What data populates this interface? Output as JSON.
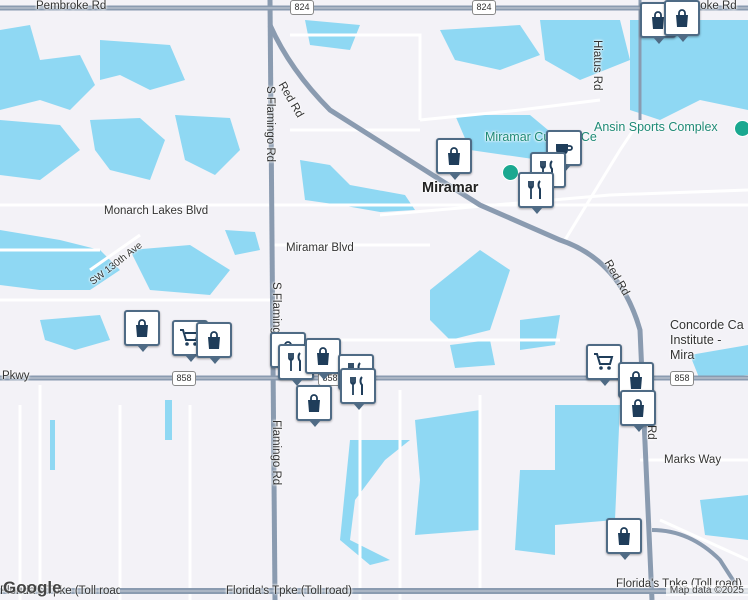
{
  "labels": {
    "pembroke_rd": "Pembroke Rd",
    "pembroke_rd_right": "broke Rd",
    "hiatus_rd": "Hiatus Rd",
    "red_rd_north": "Red Rd",
    "red_rd_east": "Red Rd",
    "red_rd_south": "Rd",
    "s_flamingo_rd_top": "S Flamingo Rd",
    "s_flamingo_rd_mid": "S Flamingo Rd",
    "flamingo_rd_south": "Flamingo Rd",
    "monarch_lakes_blvd": "Monarch Lakes Blvd",
    "miramar_blvd": "Miramar Blvd",
    "sw_130th_ave": "SW 130th Ave",
    "pkwy": "Pkwy",
    "marks_way": "Marks Way",
    "floridas_tpke_center": "Florida's Tpke (Toll road)",
    "floridas_tpke_left": "Florida's Tpke (Toll road)",
    "floridas_tpke_right": "Florida's Tpke (Toll road)",
    "miramar": "Miramar",
    "miramar_cultural_center": "Miramar Cultural Ce",
    "ansin_sports_complex": "Ansin Sports Complex",
    "concorde_institute": "Concorde Ca Institute - Mira"
  },
  "shields": {
    "route_824_left": "824",
    "route_824_right": "824",
    "route_858_left": "858",
    "route_858_mid": "858",
    "route_858_right": "858"
  },
  "attribution": {
    "google": "Google",
    "map_data": "Map data ©2025"
  },
  "colors": {
    "water": "#8fd8f3",
    "land": "#f3f2f7",
    "road_major": "#8a9bb0",
    "road_minor": "#ffffff",
    "pin_border": "#4f6b85",
    "pin_icon": "#1f3d5a"
  },
  "markers": [
    {
      "type": "shopping-bag"
    },
    {
      "type": "shopping-bag"
    },
    {
      "type": "shopping-cart"
    },
    {
      "type": "shopping-bag"
    },
    {
      "type": "shopping-bag"
    },
    {
      "type": "restaurant"
    },
    {
      "type": "shopping-bag"
    },
    {
      "type": "restaurant"
    },
    {
      "type": "restaurant"
    },
    {
      "type": "shopping-bag"
    },
    {
      "type": "shopping-cart"
    },
    {
      "type": "shopping-bag"
    },
    {
      "type": "shopping-bag"
    },
    {
      "type": "shopping-bag"
    },
    {
      "type": "coffee"
    },
    {
      "type": "restaurant"
    },
    {
      "type": "restaurant"
    },
    {
      "type": "shopping-bag"
    },
    {
      "type": "shopping-bag"
    }
  ]
}
